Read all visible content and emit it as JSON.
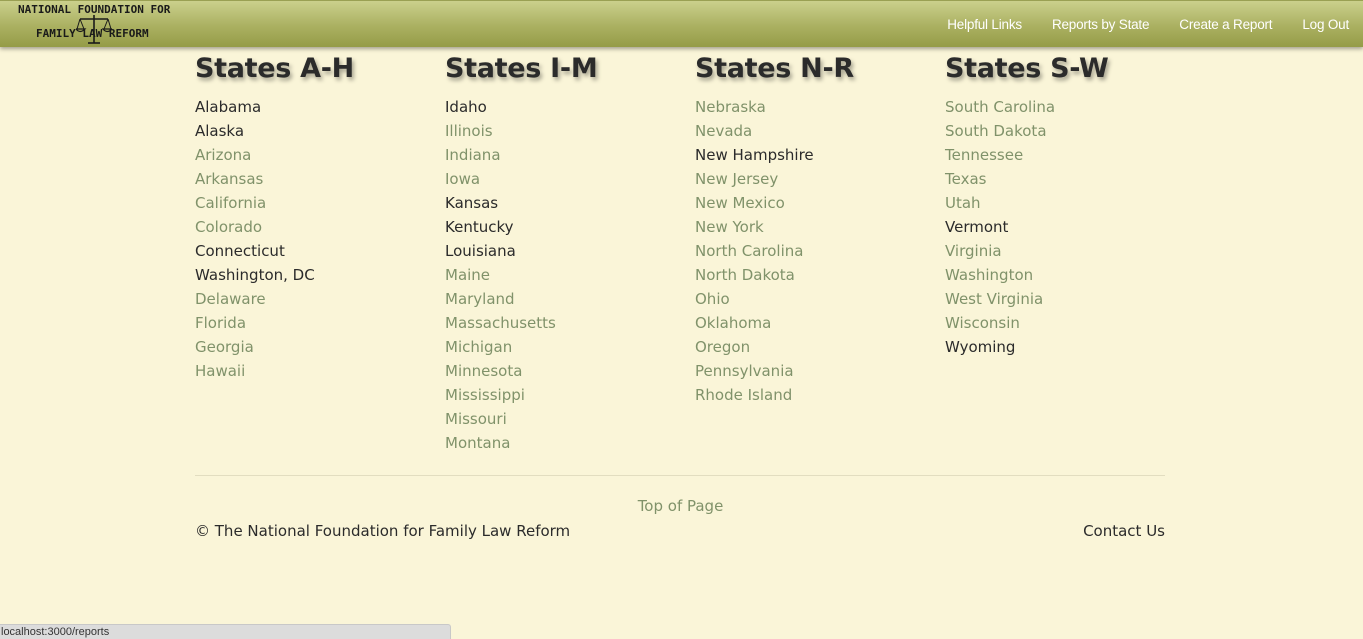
{
  "logo": {
    "line1": "NATIONAL FOUNDATION FOR",
    "line2": "FAMILY LAW REFORM"
  },
  "nav": {
    "links": [
      "Helpful Links",
      "Reports by State",
      "Create a Report",
      "Log Out"
    ]
  },
  "columns": [
    {
      "heading": "States A-H",
      "states": [
        {
          "name": "Alabama",
          "active": true
        },
        {
          "name": "Alaska",
          "active": true
        },
        {
          "name": "Arizona",
          "active": false
        },
        {
          "name": "Arkansas",
          "active": false
        },
        {
          "name": "California",
          "active": false
        },
        {
          "name": "Colorado",
          "active": false
        },
        {
          "name": "Connecticut",
          "active": true
        },
        {
          "name": "Washington, DC",
          "active": true
        },
        {
          "name": "Delaware",
          "active": false
        },
        {
          "name": "Florida",
          "active": false
        },
        {
          "name": "Georgia",
          "active": false
        },
        {
          "name": "Hawaii",
          "active": false
        }
      ]
    },
    {
      "heading": "States I-M",
      "states": [
        {
          "name": "Idaho",
          "active": true
        },
        {
          "name": "Illinois",
          "active": false
        },
        {
          "name": "Indiana",
          "active": false
        },
        {
          "name": "Iowa",
          "active": false
        },
        {
          "name": "Kansas",
          "active": true
        },
        {
          "name": "Kentucky",
          "active": true
        },
        {
          "name": "Louisiana",
          "active": true
        },
        {
          "name": "Maine",
          "active": false
        },
        {
          "name": "Maryland",
          "active": false
        },
        {
          "name": "Massachusetts",
          "active": false
        },
        {
          "name": "Michigan",
          "active": false
        },
        {
          "name": "Minnesota",
          "active": false
        },
        {
          "name": "Mississippi",
          "active": false
        },
        {
          "name": "Missouri",
          "active": false
        },
        {
          "name": "Montana",
          "active": false
        }
      ]
    },
    {
      "heading": "States N-R",
      "states": [
        {
          "name": "Nebraska",
          "active": false
        },
        {
          "name": "Nevada",
          "active": false
        },
        {
          "name": "New Hampshire",
          "active": true
        },
        {
          "name": "New Jersey",
          "active": false
        },
        {
          "name": "New Mexico",
          "active": false
        },
        {
          "name": "New York",
          "active": false
        },
        {
          "name": "North Carolina",
          "active": false
        },
        {
          "name": "North Dakota",
          "active": false
        },
        {
          "name": "Ohio",
          "active": false
        },
        {
          "name": "Oklahoma",
          "active": false
        },
        {
          "name": "Oregon",
          "active": false
        },
        {
          "name": "Pennsylvania",
          "active": false
        },
        {
          "name": "Rhode Island",
          "active": false
        }
      ]
    },
    {
      "heading": "States S-W",
      "states": [
        {
          "name": "South Carolina",
          "active": false
        },
        {
          "name": "South Dakota",
          "active": false
        },
        {
          "name": "Tennessee",
          "active": false
        },
        {
          "name": "Texas",
          "active": false
        },
        {
          "name": "Utah",
          "active": false
        },
        {
          "name": "Vermont",
          "active": true
        },
        {
          "name": "Virginia",
          "active": false
        },
        {
          "name": "Washington",
          "active": false
        },
        {
          "name": "West Virginia",
          "active": false
        },
        {
          "name": "Wisconsin",
          "active": false
        },
        {
          "name": "Wyoming",
          "active": true
        }
      ]
    }
  ],
  "footer": {
    "top_of_page": "Top of Page",
    "copyright": "© The National Foundation for Family Law Reform",
    "contact": "Contact Us"
  },
  "statusbar": {
    "url": "localhost:3000/reports"
  },
  "colors": {
    "background": "#faf5d8",
    "navbar": "#aab061",
    "active_link": "#2b2b2b",
    "inactive_link": "#80926a"
  }
}
